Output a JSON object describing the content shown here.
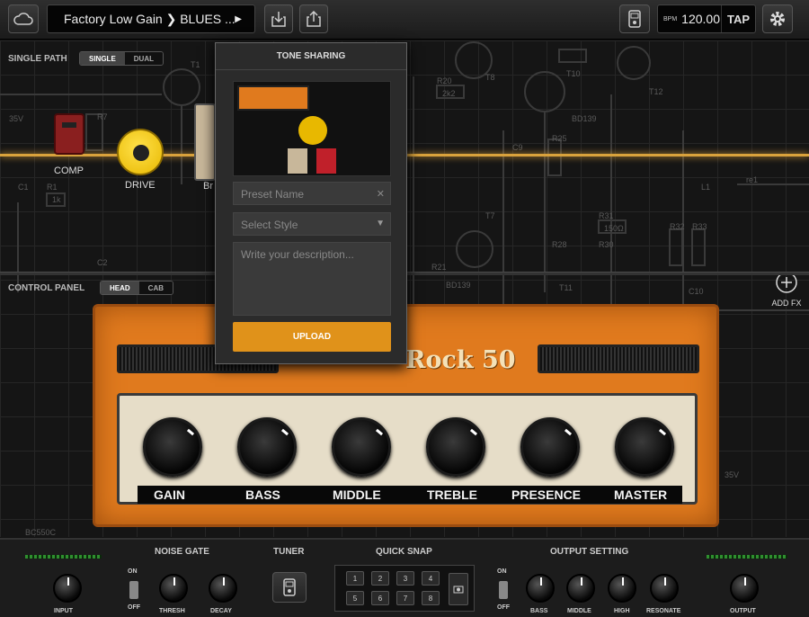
{
  "topbar": {
    "preset": "Factory Low Gain ❯ BLUES ...",
    "play_icon": "▶",
    "bpm_label": "BPM",
    "bpm": "120.00",
    "tap": "TAP"
  },
  "path": {
    "label": "SINGLE PATH",
    "single": "SINGLE",
    "dual": "DUAL"
  },
  "pedals": {
    "comp": "COMP",
    "drive": "DRIVE",
    "next": "Br"
  },
  "control": {
    "label": "CONTROL PANEL",
    "head": "HEAD",
    "cab": "CAB"
  },
  "amp": {
    "name": "Rock 50",
    "knobs": [
      "GAIN",
      "BASS",
      "MIDDLE",
      "TREBLE",
      "PRESENCE",
      "MASTER"
    ]
  },
  "add_fx": "ADD FX",
  "modal": {
    "title": "TONE SHARING",
    "preset_placeholder": "Preset Name",
    "style_placeholder": "Select Style",
    "desc_placeholder": "Write your description...",
    "upload": "UPLOAD"
  },
  "schematic": {
    "v35a": "35V",
    "v35b": "35V",
    "bd139a": "BD139",
    "bd139b": "BD139",
    "bc550": "BC550C",
    "r20": "R20",
    "r21": "R21",
    "r25": "R25",
    "r28": "R28",
    "r30": "R30",
    "r31": "R31",
    "r32": "R32",
    "r33": "R33",
    "r7": "R7",
    "r1": "R1",
    "c1": "C1",
    "c2": "C2",
    "c9": "C9",
    "c10": "C10",
    "t1": "T1",
    "t7": "T7",
    "t8": "T8",
    "t10": "T10",
    "t11": "T11",
    "t12": "T12",
    "l1": "L1",
    "re1": "re1",
    "val_2k2": "2k2",
    "val_150": "150Ω",
    "val_1k": "1k"
  },
  "bottom": {
    "input": "INPUT",
    "noise_gate": "NOISE GATE",
    "thresh": "THRESH",
    "decay": "DECAY",
    "on": "ON",
    "off": "OFF",
    "tuner": "TUNER",
    "quick_snap": "QUICK SNAP",
    "snaps": [
      "1",
      "2",
      "3",
      "4",
      "5",
      "6",
      "7",
      "8"
    ],
    "output_setting": "OUTPUT SETTING",
    "out_knobs": [
      "BASS",
      "MIDDLE",
      "HIGH",
      "RESONATE"
    ],
    "output": "OUTPUT"
  },
  "meters": {
    "input_level": 0.85,
    "output_level": 0.9
  }
}
